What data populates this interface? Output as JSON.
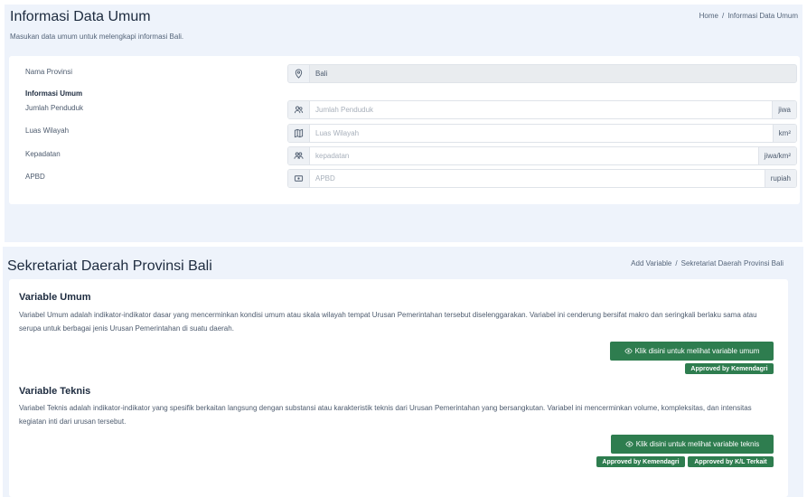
{
  "info": {
    "title": "Informasi Data Umum",
    "subtitle": "Masukan data umum untuk melengkapi informasi Bali.",
    "breadcrumb": [
      "Home",
      "Informasi Data Umum"
    ],
    "fields": {
      "provinsi_label": "Nama Provinsi",
      "provinsi_value": "Bali",
      "section_label": "Informasi Umum",
      "penduduk_label": "Jumlah Penduduk",
      "penduduk_placeholder": "Jumlah Penduduk",
      "penduduk_suffix": "jiwa",
      "luas_label": "Luas Wilayah",
      "luas_placeholder": "Luas Wilayah",
      "luas_suffix": "km²",
      "kepadatan_label": "Kepadatan",
      "kepadatan_placeholder": "kepadatan",
      "kepadatan_suffix": "jiwa/km²",
      "apbd_label": "APBD",
      "apbd_placeholder": "APBD",
      "apbd_suffix": "rupiah"
    }
  },
  "sekretariat": {
    "title": "Sekretariat Daerah Provinsi Bali",
    "breadcrumb": [
      "Add Variable",
      "Sekretariat Daerah Provinsi Bali"
    ],
    "umum": {
      "heading": "Variable Umum",
      "description": "Variabel Umum adalah indikator-indikator dasar yang mencerminkan kondisi umum atau skala wilayah tempat Urusan Pemerintahan tersebut diselenggarakan. Variabel ini cenderung bersifat makro dan seringkali berlaku sama atau serupa untuk berbagai jenis Urusan Pemerintahan di suatu daerah.",
      "button": "Klik disini untuk melihat variable umum",
      "badges": [
        "Approved by Kemendagri"
      ]
    },
    "teknis": {
      "heading": "Variable Teknis",
      "description": "Variabel Teknis adalah indikator-indikator yang spesifik berkaitan langsung dengan substansi atau karakteristik teknis dari Urusan Pemerintahan yang bersangkutan. Variabel ini mencerminkan volume, kompleksitas, dan intensitas kegiatan inti dari urusan tersebut.",
      "button": "Klik disini untuk melihat variable teknis",
      "badges": [
        "Approved by Kemendagri",
        "Approved by K/L Terkait"
      ]
    }
  },
  "icons": {
    "provinsi": "map-pin-icon",
    "penduduk": "users-icon",
    "luas": "map-icon",
    "kepadatan": "users-group-icon",
    "apbd": "money-icon",
    "button": "eye-icon"
  },
  "colors": {
    "accent_green": "#2e7d4f",
    "section_bg": "#eef3fb"
  }
}
